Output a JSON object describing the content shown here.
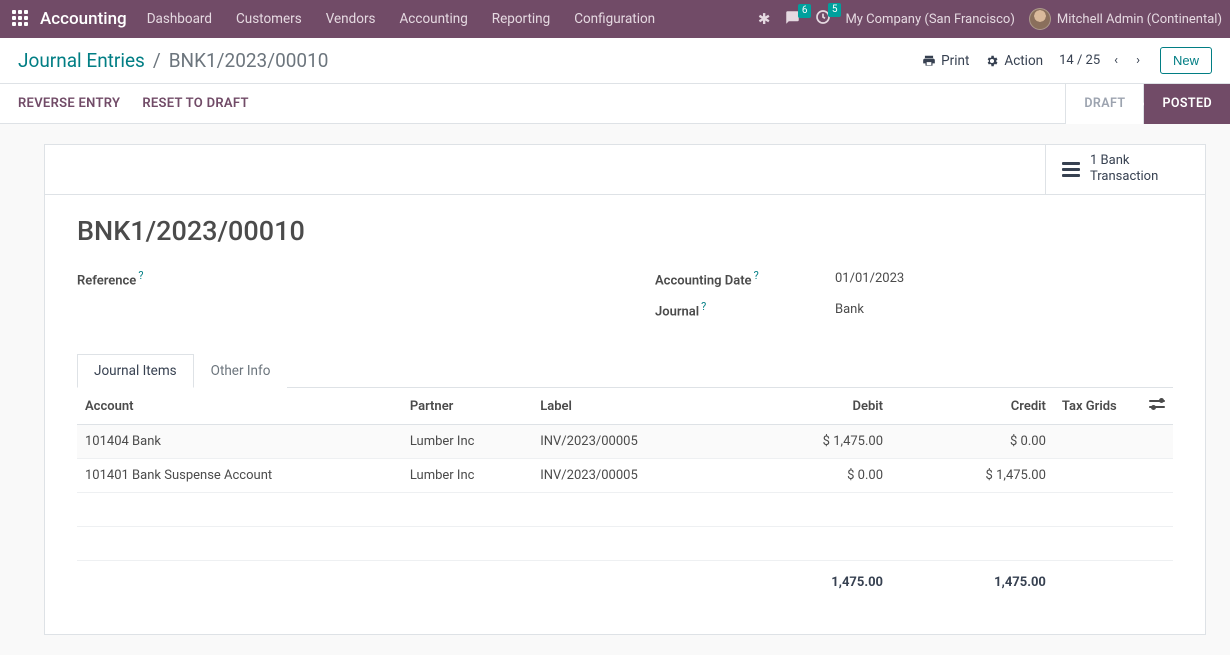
{
  "nav": {
    "brand": "Accounting",
    "menu": [
      "Dashboard",
      "Customers",
      "Vendors",
      "Accounting",
      "Reporting",
      "Configuration"
    ],
    "msg_count": "6",
    "activity_count": "5",
    "company": "My Company (San Francisco)",
    "user": "Mitchell Admin (Continental)"
  },
  "breadcrumb": {
    "root": "Journal Entries",
    "current": "BNK1/2023/00010"
  },
  "controls": {
    "print": "Print",
    "action": "Action",
    "pager": "14 / 25",
    "new": "New"
  },
  "actions": {
    "reverse": "REVERSE ENTRY",
    "reset": "RESET TO DRAFT"
  },
  "status": {
    "draft": "DRAFT",
    "posted": "POSTED"
  },
  "stat": {
    "line1": "1 Bank",
    "line2": "Transaction"
  },
  "record": {
    "title": "BNK1/2023/00010",
    "labels": {
      "ref": "Reference",
      "date": "Accounting Date",
      "journal": "Journal"
    },
    "date": "01/01/2023",
    "journal": "Bank"
  },
  "tabs": {
    "items": "Journal Items",
    "other": "Other Info"
  },
  "table": {
    "headers": {
      "account": "Account",
      "partner": "Partner",
      "label": "Label",
      "debit": "Debit",
      "credit": "Credit",
      "tax": "Tax Grids"
    },
    "rows": [
      {
        "account": "101404 Bank",
        "partner": "Lumber Inc",
        "label": "INV/2023/00005",
        "debit": "$ 1,475.00",
        "credit": "$ 0.00"
      },
      {
        "account": "101401 Bank Suspense Account",
        "partner": "Lumber Inc",
        "label": "INV/2023/00005",
        "debit": "$ 0.00",
        "credit": "$ 1,475.00"
      }
    ],
    "totals": {
      "debit": "1,475.00",
      "credit": "1,475.00"
    }
  }
}
